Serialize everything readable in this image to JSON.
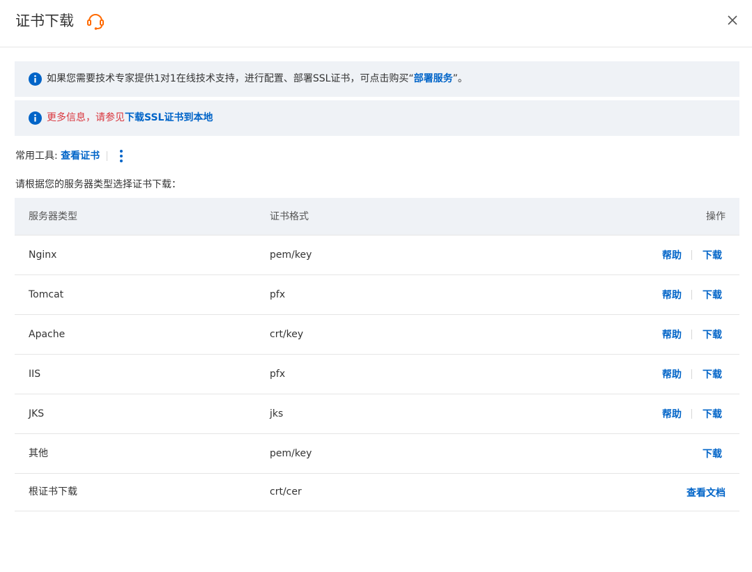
{
  "header": {
    "title": "证书下载",
    "support_icon": "headset-icon",
    "close_icon": "close-icon"
  },
  "notices": {
    "first": {
      "icon": "info-icon",
      "prefix": "如果您需要技术专家提供1对1在线技术支持，进行配置、部署SSL证书，可点击购买“",
      "link": "部署服务",
      "suffix": "”。"
    },
    "second": {
      "icon": "info-icon",
      "prefix": "更多信息，请参见",
      "link": "下载SSL证书到本地"
    }
  },
  "tools": {
    "label": "常用工具:",
    "link": "查看证书",
    "more_icon": "more-vertical-icon"
  },
  "instruction": "请根据您的服务器类型选择证书下载：",
  "table": {
    "headers": [
      "服务器类型",
      "证书格式",
      "操作"
    ],
    "rows": [
      {
        "server": "Nginx",
        "format": "pem/key",
        "help": "帮助",
        "download": "下载"
      },
      {
        "server": "Tomcat",
        "format": "pfx",
        "help": "帮助",
        "download": "下载"
      },
      {
        "server": "Apache",
        "format": "crt/key",
        "help": "帮助",
        "download": "下载"
      },
      {
        "server": "IIS",
        "format": "pfx",
        "help": "帮助",
        "download": "下载"
      },
      {
        "server": "JKS",
        "format": "jks",
        "help": "帮助",
        "download": "下载"
      },
      {
        "server": "其他",
        "format": "pem/key",
        "download": "下载"
      },
      {
        "server": "根证书下载",
        "format": "crt/cer",
        "doc": "查看文档"
      }
    ]
  },
  "colors": {
    "accent": "#0064c8",
    "warning_text": "#d9363e",
    "notice_bg": "#eff2f6",
    "support_icon": "#ff6a00"
  }
}
